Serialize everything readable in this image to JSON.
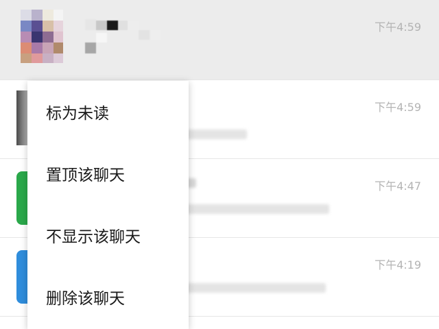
{
  "chats": [
    {
      "time": "下午4:59"
    },
    {
      "time": "下午4:59"
    },
    {
      "time": "下午4:47"
    },
    {
      "time": "下午4:19"
    }
  ],
  "context_menu": {
    "items": [
      {
        "label": "标为未读"
      },
      {
        "label": "置顶该聊天"
      },
      {
        "label": "不显示该聊天"
      },
      {
        "label": "删除该聊天"
      }
    ]
  },
  "colors": {
    "active_row_bg": "#ececec",
    "time_text": "#b3b3b3",
    "divider": "#e6e6e6",
    "avatar_green": "#2aa84a",
    "avatar_blue": "#2f8ddc"
  }
}
